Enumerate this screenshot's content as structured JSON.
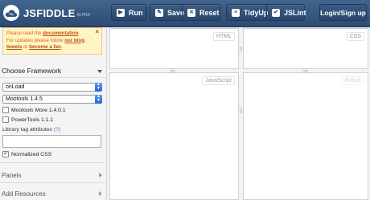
{
  "brand": {
    "name": "JSFIDDLE",
    "tag": "ALPHA"
  },
  "toolbar": {
    "run": "Run",
    "save": "Save",
    "reset": "Reset",
    "tidyup": "TidyUp",
    "jslint": "JSLint",
    "login": "Login/Sign up"
  },
  "notice": {
    "line1_prefix": "Please read the ",
    "documentation": "documentation",
    "line1_suffix": ".",
    "line2_prefix": "For updates please follow ",
    "blog": "our blog",
    "comma": ",",
    "tweets": "tweets",
    "or": " or ",
    "fan": "become a fan",
    "end": ".",
    "close": "×"
  },
  "sidebar": {
    "framework_title": "Choose Framework",
    "load_select": "onLoad",
    "framework_select": "Mootools 1.4.5",
    "option1": "Mootools More 1.4.0.1",
    "option2": "PowerTools 1.1.1",
    "lib_label": "Library tag attributes",
    "lib_help": "(?)",
    "normalized": "Normalized CSS",
    "panels": "Panels",
    "add_resources": "Add Resources"
  },
  "editors": {
    "html": "HTML",
    "css": "CSS",
    "js": "JavaScript",
    "result": "Result"
  },
  "icons": {
    "logo": "cloud-icon",
    "run": "play-icon",
    "save": "pencil-icon",
    "reset": "x-icon",
    "tidyup": "brackets-icon",
    "jslint": "checkmark-icon"
  }
}
